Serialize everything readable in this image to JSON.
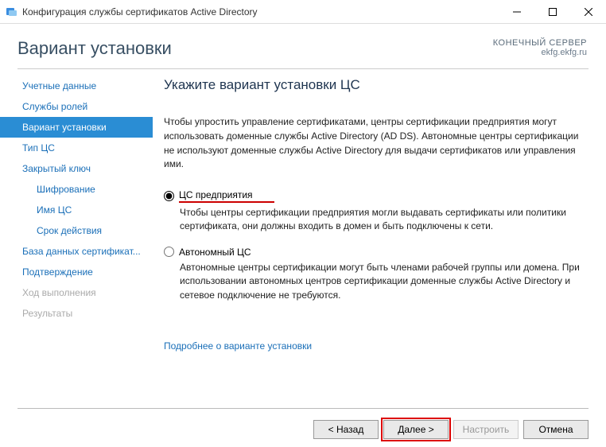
{
  "window": {
    "title": "Конфигурация службы сертификатов Active Directory"
  },
  "header": {
    "title": "Вариант установки",
    "role": "КОНЕЧНЫЙ СЕРВЕР",
    "server": "ekfg.ekfg.ru"
  },
  "sidebar": {
    "items": [
      {
        "label": "Учетные данные",
        "state": "normal"
      },
      {
        "label": "Службы ролей",
        "state": "normal"
      },
      {
        "label": "Вариант установки",
        "state": "active"
      },
      {
        "label": "Тип ЦС",
        "state": "normal"
      },
      {
        "label": "Закрытый ключ",
        "state": "normal"
      },
      {
        "label": "Шифрование",
        "state": "sub"
      },
      {
        "label": "Имя ЦС",
        "state": "sub"
      },
      {
        "label": "Срок действия",
        "state": "sub"
      },
      {
        "label": "База данных сертификат...",
        "state": "normal"
      },
      {
        "label": "Подтверждение",
        "state": "normal"
      },
      {
        "label": "Ход выполнения",
        "state": "disabled"
      },
      {
        "label": "Результаты",
        "state": "disabled"
      }
    ]
  },
  "content": {
    "title": "Укажите вариант установки ЦС",
    "description": "Чтобы упростить управление сертификатами, центры сертификации предприятия могут использовать доменные службы Active Directory (AD DS). Автономные центры сертификации не используют доменные службы Active Directory для выдачи сертификатов или управления ими.",
    "option1": {
      "label": "ЦС предприятия",
      "checked": true,
      "sub": "Чтобы центры сертификации предприятия могли выдавать сертификаты или политики сертификата, они должны входить в домен и быть подключены к сети."
    },
    "option2": {
      "label": "Автономный ЦС",
      "checked": false,
      "sub": "Автономные центры сертификации могут быть членами рабочей группы или домена. При использовании автономных центров сертификации доменные службы Active Directory и сетевое подключение не требуются."
    },
    "moreLink": "Подробнее о варианте установки"
  },
  "footer": {
    "back": "< Назад",
    "next": "Далее >",
    "configure": "Настроить",
    "cancel": "Отмена"
  }
}
